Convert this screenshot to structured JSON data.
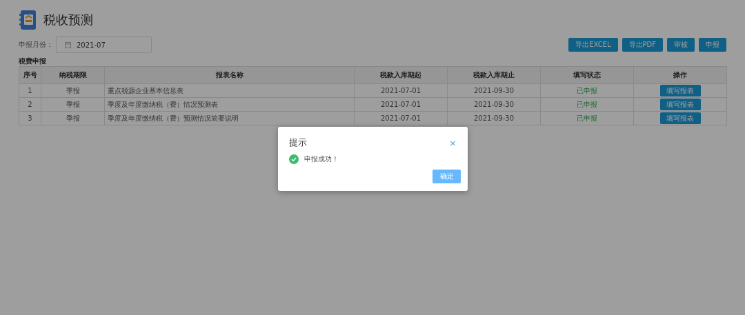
{
  "header": {
    "title": "税收预测"
  },
  "filter": {
    "label": "申报月份：",
    "value": "2021-07"
  },
  "toolbar": {
    "buttons": [
      "导出EXCEL",
      "导出PDF",
      "审核",
      "申报"
    ]
  },
  "section_title": "税费申报",
  "table": {
    "columns": [
      "序号",
      "纳税期限",
      "报表名称",
      "税款入库期起",
      "税款入库期止",
      "填写状态",
      "操作"
    ],
    "rows": [
      {
        "cells": [
          "1",
          "季报",
          "重点税源企业基本信息表",
          "2021-07-01",
          "2021-09-30"
        ],
        "status": "已申报",
        "action": "填写报表"
      },
      {
        "cells": [
          "2",
          "季报",
          "季度及年度缴纳税（费）情况预测表",
          "2021-07-01",
          "2021-09-30"
        ],
        "status": "已申报",
        "action": "填写报表"
      },
      {
        "cells": [
          "3",
          "季报",
          "季度及年度缴纳税（费）预测情况简要说明",
          "2021-07-01",
          "2021-09-30"
        ],
        "status": "已申报",
        "action": "填写报表"
      }
    ]
  },
  "dialog": {
    "title": "提示",
    "close": "×",
    "message": "申报成功！",
    "confirm": "确定"
  }
}
